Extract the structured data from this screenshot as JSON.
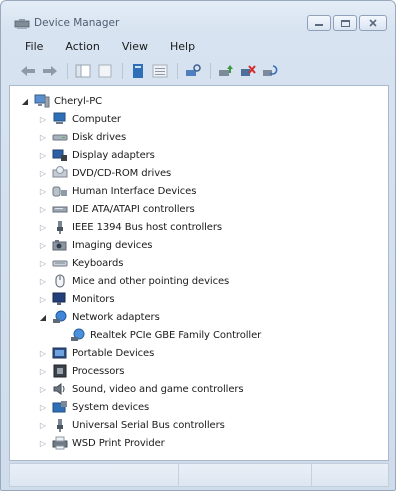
{
  "window": {
    "title": "Device Manager",
    "controls": {
      "minimize": "minimize-icon",
      "maximize": "maximize-icon",
      "close": "close-icon"
    }
  },
  "menu": [
    "File",
    "Action",
    "View",
    "Help"
  ],
  "toolbar": [
    "back-arrow-icon",
    "forward-arrow-icon",
    "separator",
    "show-hide-tree-icon",
    "properties-icon",
    "separator",
    "help-icon",
    "view-details-icon",
    "separator",
    "scan-hardware-icon",
    "separator",
    "update-driver-icon",
    "disable-device-icon",
    "uninstall-device-icon"
  ],
  "tree": {
    "root": {
      "label": "Cheryl-PC",
      "icon": "computer-icon",
      "expanded": true
    },
    "items": [
      {
        "label": "Computer",
        "icon": "computer-icon",
        "expanded": false
      },
      {
        "label": "Disk drives",
        "icon": "disk-drive-icon",
        "expanded": false
      },
      {
        "label": "Display adapters",
        "icon": "display-adapter-icon",
        "expanded": false
      },
      {
        "label": "DVD/CD-ROM drives",
        "icon": "dvd-drive-icon",
        "expanded": false
      },
      {
        "label": "Human Interface Devices",
        "icon": "hid-icon",
        "expanded": false
      },
      {
        "label": "IDE ATA/ATAPI controllers",
        "icon": "ide-controller-icon",
        "expanded": false
      },
      {
        "label": "IEEE 1394 Bus host controllers",
        "icon": "firewire-icon",
        "expanded": false
      },
      {
        "label": "Imaging devices",
        "icon": "camera-icon",
        "expanded": false
      },
      {
        "label": "Keyboards",
        "icon": "keyboard-icon",
        "expanded": false
      },
      {
        "label": "Mice and other pointing devices",
        "icon": "mouse-icon",
        "expanded": false
      },
      {
        "label": "Monitors",
        "icon": "monitor-icon",
        "expanded": false
      },
      {
        "label": "Network adapters",
        "icon": "network-adapter-icon",
        "expanded": true,
        "children": [
          {
            "label": "Realtek PCIe GBE Family Controller",
            "icon": "network-card-icon"
          }
        ]
      },
      {
        "label": "Portable Devices",
        "icon": "portable-device-icon",
        "expanded": false
      },
      {
        "label": "Processors",
        "icon": "processor-icon",
        "expanded": false
      },
      {
        "label": "Sound, video and game controllers",
        "icon": "speaker-icon",
        "expanded": false
      },
      {
        "label": "System devices",
        "icon": "system-device-icon",
        "expanded": false
      },
      {
        "label": "Universal Serial Bus controllers",
        "icon": "usb-icon",
        "expanded": false
      },
      {
        "label": "WSD Print Provider",
        "icon": "printer-icon",
        "expanded": false
      }
    ]
  },
  "colors": {
    "accent_blue": "#2f6fb8",
    "frame": "#d7e3f0",
    "tree_bg": "#ffffff"
  }
}
